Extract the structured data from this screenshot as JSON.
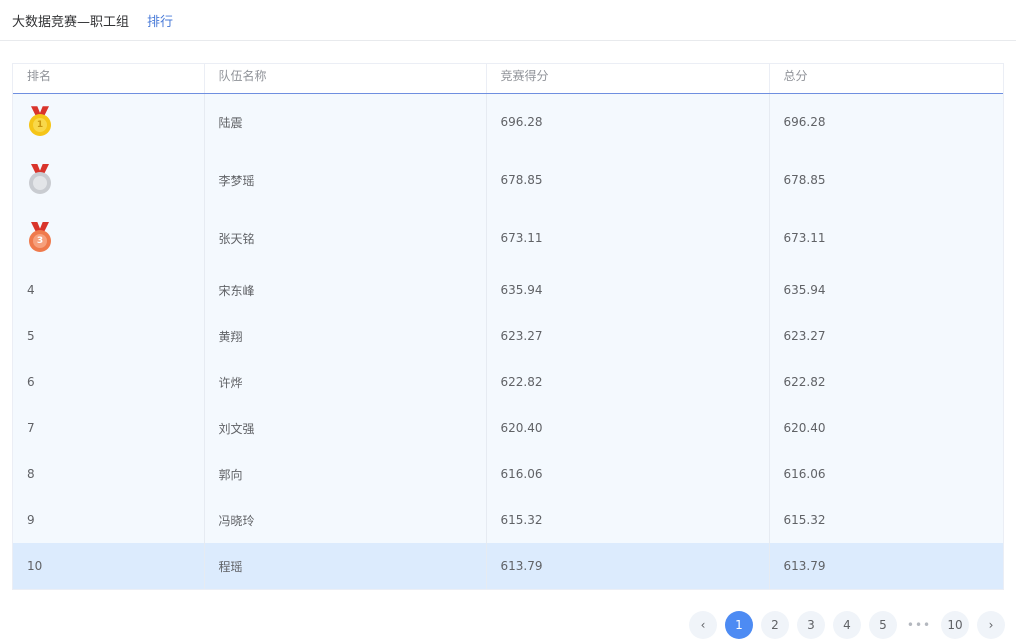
{
  "header": {
    "title": "大数据竞赛—职工组",
    "crumb": "排行"
  },
  "table": {
    "columns": [
      "排名",
      "队伍名称",
      "竞赛得分",
      "总分"
    ],
    "rows": [
      {
        "rank": "1",
        "team": "陆震",
        "score": "696.28",
        "total": "696.28",
        "medal": "gold-medal-icon"
      },
      {
        "rank": "2",
        "team": "李梦瑶",
        "score": "678.85",
        "total": "678.85",
        "medal": "silver-medal-icon"
      },
      {
        "rank": "3",
        "team": "张天铭",
        "score": "673.11",
        "total": "673.11",
        "medal": "bronze-medal-icon"
      },
      {
        "rank": "4",
        "team": "宋东峰",
        "score": "635.94",
        "total": "635.94"
      },
      {
        "rank": "5",
        "team": "黄翔",
        "score": "623.27",
        "total": "623.27"
      },
      {
        "rank": "6",
        "team": "许烨",
        "score": "622.82",
        "total": "622.82"
      },
      {
        "rank": "7",
        "team": "刘文强",
        "score": "620.40",
        "total": "620.40"
      },
      {
        "rank": "8",
        "team": "郭向",
        "score": "616.06",
        "total": "616.06"
      },
      {
        "rank": "9",
        "team": "冯晓玲",
        "score": "615.32",
        "total": "615.32"
      },
      {
        "rank": "10",
        "team": "程瑶",
        "score": "613.79",
        "total": "613.79"
      }
    ],
    "highlighted_row": "10"
  },
  "pagination": {
    "prev": "‹",
    "pages": [
      "1",
      "2",
      "3",
      "4",
      "5"
    ],
    "current": "1",
    "ellipsis": "•••",
    "last": "10",
    "next": "›"
  },
  "colors": {
    "accent": "#4d8bf3",
    "gold": "#f5c518",
    "silver": "#c9ccd1",
    "bronze": "#ef7a4c"
  }
}
